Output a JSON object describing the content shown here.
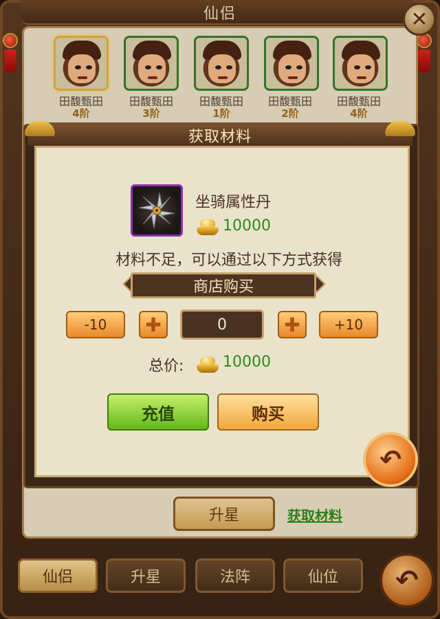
{
  "window": {
    "title": "仙侣"
  },
  "characters": [
    {
      "name": "田馥甄田",
      "rank": "4阶",
      "selected": true
    },
    {
      "name": "田馥甄田",
      "rank": "3阶",
      "selected": false
    },
    {
      "name": "田馥甄田",
      "rank": "1阶",
      "selected": false
    },
    {
      "name": "田馥甄田",
      "rank": "2阶",
      "selected": false
    },
    {
      "name": "田馥甄田",
      "rank": "4阶",
      "selected": false
    }
  ],
  "base_panel": {
    "upgrade_label": "升星",
    "get_material_link": "获取材料"
  },
  "bottom_tabs": [
    {
      "label": "仙侣",
      "active": true
    },
    {
      "label": "升星",
      "active": false
    },
    {
      "label": "法阵",
      "active": false
    },
    {
      "label": "仙位",
      "active": false
    }
  ],
  "dialog": {
    "title": "获取材料",
    "item": {
      "name": "坐骑属性丹",
      "icon": "shuriken-icon",
      "price": "10000",
      "currency_icon": "gold-ingot-icon"
    },
    "hint": "材料不足，可以通过以下方式获得",
    "shop_banner": "商店购买",
    "quantity": {
      "minus10": "-10",
      "value": "0",
      "plus10": "+10"
    },
    "total": {
      "label": "总价:",
      "amount": "10000"
    },
    "recharge_label": "充值",
    "buy_label": "购买"
  },
  "colors": {
    "price_green": "#2f8a1a",
    "rarity_purple": "#8c2fb7",
    "accent_orange": "#e8892a"
  }
}
